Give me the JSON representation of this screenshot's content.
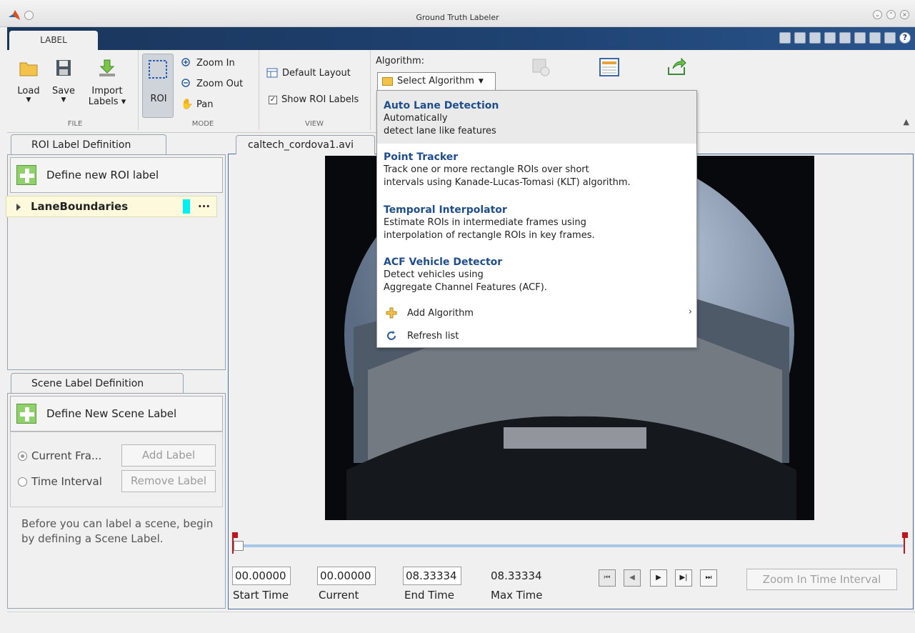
{
  "window": {
    "title": "Ground Truth Labeler"
  },
  "ribbon": {
    "tab": "LABEL",
    "file": {
      "load": "Load",
      "save": "Save",
      "import": "Import",
      "import2": "Labels",
      "section": "FILE"
    },
    "mode": {
      "roi": "ROI",
      "zoom_in": "Zoom In",
      "zoom_out": "Zoom Out",
      "pan": "Pan",
      "section": "MODE"
    },
    "view": {
      "default_layout": "Default Layout",
      "show_roi_labels": "Show ROI Labels",
      "section": "VIEW"
    },
    "algorithm": {
      "label": "Algorithm:",
      "select": "Select Algorithm"
    }
  },
  "roi_panel": {
    "tab": "ROI Label Definition",
    "define_button": "Define new ROI label",
    "labels": [
      {
        "name": "LaneBoundaries",
        "color": "#00f0f0"
      }
    ]
  },
  "scene_panel": {
    "tab": "Scene Label Definition",
    "define_button": "Define New Scene Label",
    "radio_current": "Current Fra...",
    "radio_interval": "Time Interval",
    "add_label": "Add Label",
    "remove_label": "Remove Label",
    "hint": "Before you can label a scene, begin by defining a Scene Label."
  },
  "video": {
    "tab": "caltech_cordova1.avi",
    "start_time": "00.00000",
    "current": "00.00000",
    "end_time": "08.33334",
    "max_time": "08.33334",
    "labels": {
      "start": "Start Time",
      "current": "Current",
      "end": "End Time",
      "max": "Max Time"
    },
    "zoom_button": "Zoom In Time Interval"
  },
  "dropdown": {
    "items": [
      {
        "title": "Auto Lane Detection",
        "line1": "Automatically",
        "line2": "detect lane like features"
      },
      {
        "title": "Point Tracker",
        "line1": "Track one or more rectangle ROIs over short",
        "line2": "intervals using Kanade-Lucas-Tomasi (KLT) algorithm."
      },
      {
        "title": "Temporal Interpolator",
        "line1": "Estimate ROIs in intermediate frames using",
        "line2": "interpolation of rectangle ROIs in key frames."
      },
      {
        "title": "ACF Vehicle Detector",
        "line1": "Detect vehicles using",
        "line2": "Aggregate Channel Features (ACF)."
      }
    ],
    "add_algorithm": "Add Algorithm",
    "refresh": "Refresh list"
  }
}
